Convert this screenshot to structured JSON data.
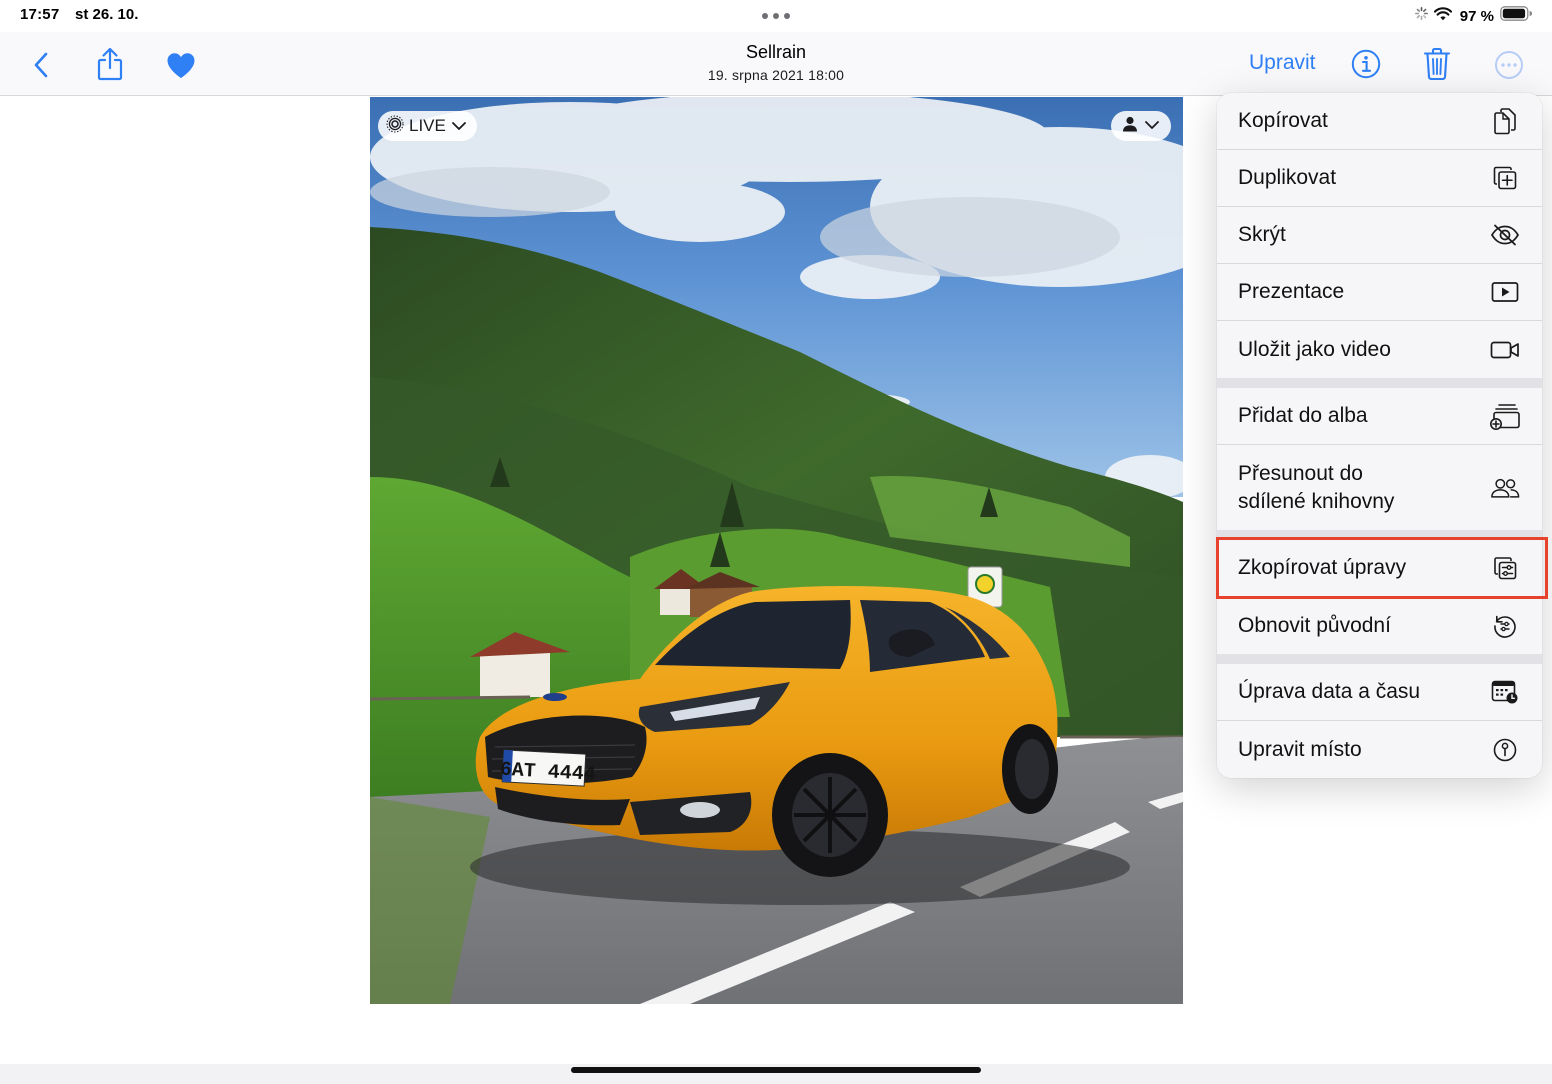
{
  "status_bar": {
    "time": "17:57",
    "date": "st 26. 10.",
    "battery_percent": "97 %",
    "battery_level": 0.97
  },
  "nav": {
    "title": "Sellrain",
    "subtitle": "19. srpna 2021  18:00",
    "edit_label": "Upravit",
    "accent_color": "#2f7ff5",
    "icons": [
      "back-chevron-icon",
      "share-icon",
      "heart-icon",
      "info-icon",
      "trash-icon",
      "more-icon"
    ]
  },
  "photo": {
    "live_label": "LIVE",
    "plate_text": "6AT 4444"
  },
  "menu": {
    "groups": [
      [
        {
          "label": "Kopírovat",
          "icon": "doc-copy-icon"
        },
        {
          "label": "Duplikovat",
          "icon": "plus-square-on-square-icon"
        },
        {
          "label": "Skrýt",
          "icon": "eye-slash-icon"
        },
        {
          "label": "Prezentace",
          "icon": "play-rectangle-icon"
        },
        {
          "label": "Uložit jako video",
          "icon": "video-icon"
        }
      ],
      [
        {
          "label": "Přidat do alba",
          "icon": "add-to-album-icon"
        },
        {
          "label": "Přesunout do sdílené knihovny",
          "line1": "Přesunout do",
          "line2": "sdílené knihovny",
          "icon": "shared-library-icon"
        }
      ],
      [
        {
          "label": "Zkopírovat úpravy",
          "icon": "copy-edits-icon",
          "highlighted": true
        },
        {
          "label": "Obnovit původní",
          "icon": "revert-icon"
        }
      ],
      [
        {
          "label": "Úprava data a času",
          "icon": "calendar-clock-icon"
        },
        {
          "label": "Upravit místo",
          "icon": "location-info-icon"
        }
      ]
    ],
    "highlight_color": "#e8412c"
  }
}
